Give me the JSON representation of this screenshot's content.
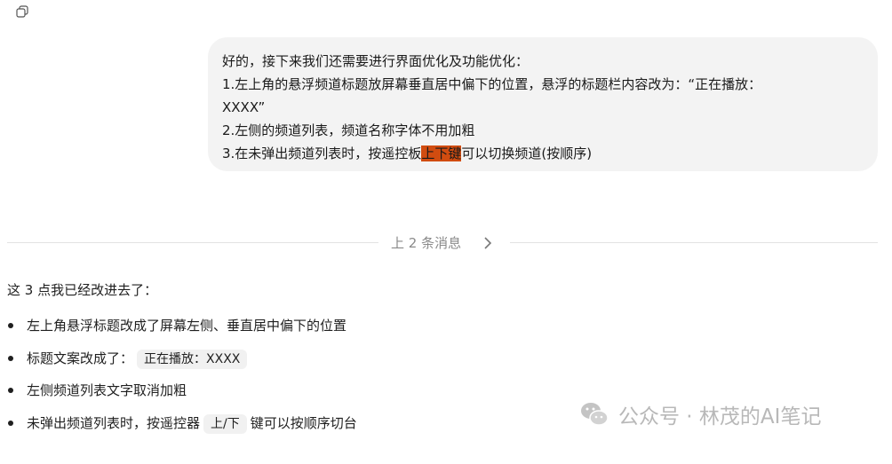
{
  "user_message": {
    "lines": [
      "好的，接下来我们还需要进行界面优化及功能优化：",
      "1.左上角的悬浮频道标题放屏幕垂直居中偏下的位置，悬浮的标题栏内容改为：“正在播放：",
      "XXXX”",
      "2.左侧的频道列表，频道名称字体不用加粗"
    ],
    "line5_before": "3.在未弹出频道列表时，按遥控板",
    "line5_highlight": "上下键",
    "line5_after": "可以切换频道(按顺序)"
  },
  "divider": {
    "label": "上 2 条消息"
  },
  "reply": {
    "intro": "这 3 点我已经改进去了：",
    "bullet1": "左上角悬浮标题改成了屏幕左侧、垂直居中偏下的位置",
    "bullet2_before": "标题文案改成了：",
    "bullet2_code": "正在播放：XXXX",
    "bullet3": "左侧频道列表文字取消加粗",
    "bullet4_before": "未弹出频道列表时，按遥控器",
    "bullet4_code": "上/下",
    "bullet4_after": "键可以按顺序切台"
  },
  "watermark": {
    "text": "公众号 · 林茂的AI笔记",
    "icon": "wechat-icon"
  },
  "icons": {
    "copy": "copy-icon",
    "chevron": "chevron-right-icon"
  },
  "colors": {
    "highlight": "#d14c10",
    "bubble": "#f3f3f3"
  }
}
